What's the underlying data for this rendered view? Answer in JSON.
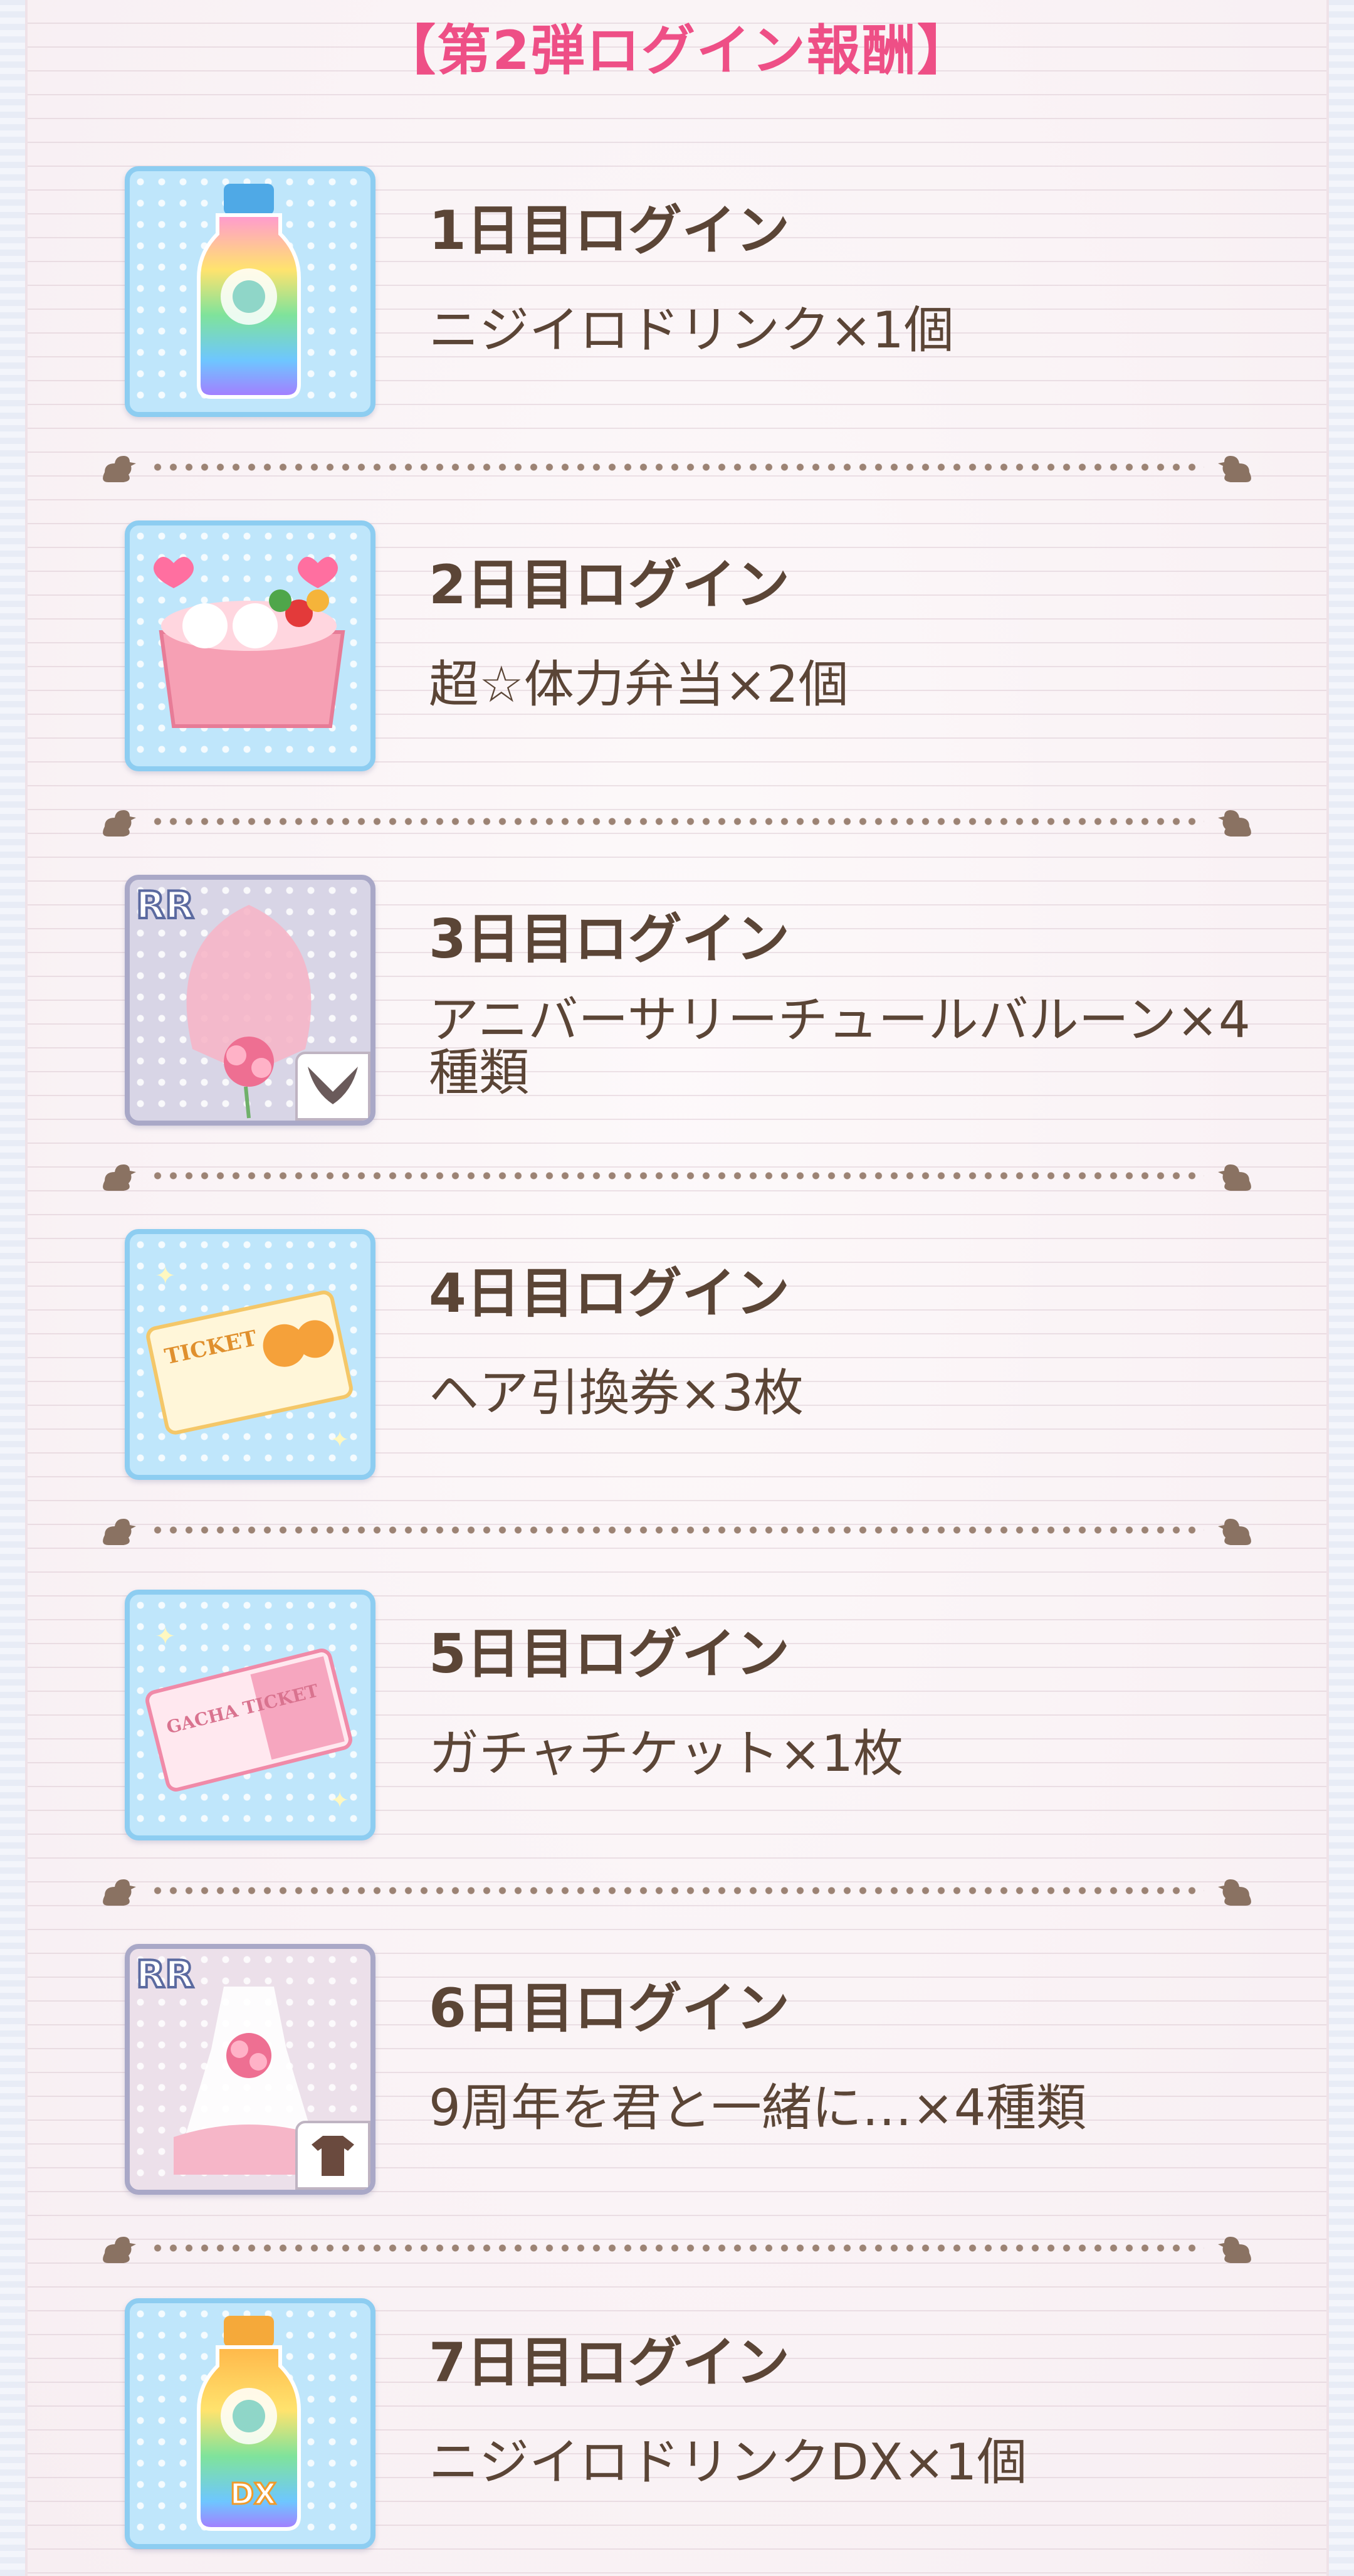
{
  "header": {
    "title": "【第2弾ログイン報酬】"
  },
  "rewards": [
    {
      "day": "1日目ログイン",
      "item": "ニジイロドリンク×1個",
      "icon": "rainbow-drink-icon"
    },
    {
      "day": "2日目ログイン",
      "item": "超☆体力弁当×2個",
      "icon": "bento-box-icon"
    },
    {
      "day": "3日目ログイン",
      "item": "アニバーサリーチュールバルーン×4種類",
      "icon": "tulle-balloon-icon",
      "badge": "RR"
    },
    {
      "day": "4日目ログイン",
      "item": "ヘア引換券×3枚",
      "icon": "hair-ticket-icon",
      "ticket_text": "TICKET"
    },
    {
      "day": "5日目ログイン",
      "item": "ガチャチケット×1枚",
      "icon": "gacha-ticket-icon",
      "ticket_text": "GACHA TICKET"
    },
    {
      "day": "6日目ログイン",
      "item": "9周年を君と一緒に…×4種類",
      "icon": "anniversary-dress-icon",
      "badge": "RR"
    },
    {
      "day": "7日目ログイン",
      "item": "ニジイロドリンクDX×1個",
      "icon": "rainbow-drink-dx-icon",
      "label": "DX"
    }
  ],
  "colors": {
    "title": "#ee4f86",
    "text": "#5b4536",
    "thumb_border": "#8dcdf1",
    "divider": "#9c8374"
  }
}
